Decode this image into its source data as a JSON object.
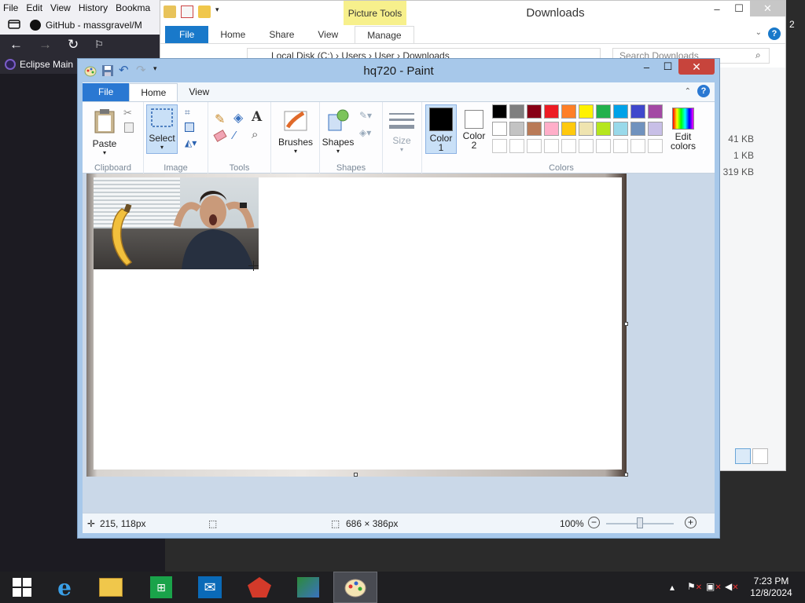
{
  "browser": {
    "menu": [
      "File",
      "Edit",
      "View",
      "History",
      "Bookma"
    ],
    "tab_title": "GitHub - massgravel/M",
    "bookmark": "Eclipse Main"
  },
  "explorer": {
    "title": "Downloads",
    "contextual_tab": "Picture Tools",
    "tabs": [
      "File",
      "Home",
      "Share",
      "View",
      "Manage"
    ],
    "address": "Local Disk (C:) › Users › User › Downloads",
    "search_placeholder": "Search Downloads",
    "sizes": [
      "41 KB",
      "1 KB",
      "319 KB"
    ],
    "side_number": "2"
  },
  "paint": {
    "title": "hq720 - Paint",
    "tabs": [
      "File",
      "Home",
      "View"
    ],
    "groups": {
      "clipboard": "Clipboard",
      "image": "Image",
      "tools": "Tools",
      "shapes": "Shapes",
      "colors": "Colors"
    },
    "buttons": {
      "paste": "Paste",
      "select": "Select",
      "brushes": "Brushes",
      "shapes": "Shapes",
      "size": "Size",
      "color1_line1": "Color",
      "color1_line2": "1",
      "color2_line1": "Color",
      "color2_line2": "2",
      "edit_colors_line1": "Edit",
      "edit_colors_line2": "colors"
    },
    "palette": [
      "#000000",
      "#7f7f7f",
      "#880015",
      "#ed1c24",
      "#ff7f27",
      "#fff200",
      "#22b14c",
      "#00a2e8",
      "#3f48cc",
      "#a349a4",
      "#ffffff",
      "#c3c3c3",
      "#b97a57",
      "#ffaec9",
      "#ffc90e",
      "#efe4b0",
      "#b5e61d",
      "#99d9ea",
      "#7092be",
      "#c8bfe7",
      "#ffffff",
      "#ffffff",
      "#ffffff",
      "#ffffff",
      "#ffffff",
      "#ffffff",
      "#ffffff",
      "#ffffff",
      "#ffffff",
      "#ffffff"
    ],
    "color1": "#000000",
    "color2": "#ffffff",
    "status": {
      "cursor": "215, 118px",
      "size": "686 × 386px",
      "zoom": "100%",
      "zoom_fraction": 0.5
    }
  },
  "taskbar": {
    "time": "7:23 PM",
    "date": "12/8/2024"
  }
}
